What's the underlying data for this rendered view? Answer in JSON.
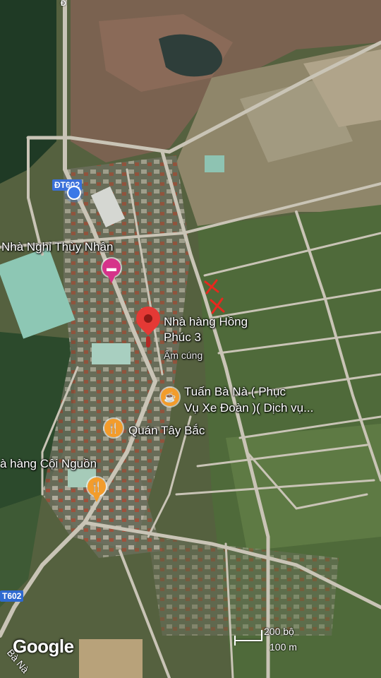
{
  "labels": {
    "hotel": "Nhà Nghỉ Thùy Nhân",
    "restaurant_main_line1": "Nhà hàng Hồng",
    "restaurant_main_line2": "Phúc 3",
    "restaurant_main_sub": "Ấm cúng",
    "tuan_line1": "Tuấn Bà Nà ( Phục",
    "tuan_line2": "Vụ Xe Đoàn )( Dịch vụ...",
    "quan_tay_bac": "Quán Tây Bắc",
    "coi_nguon": "à hàng Cội Nguồn"
  },
  "roads": {
    "dt602_top": "ĐT602",
    "t602_bottom": "T602",
    "ba_na": "Bà Nà",
    "top_marker": "Đ"
  },
  "scale": {
    "feet": "200 bộ",
    "meters": "100 m"
  },
  "brand": "Google",
  "colors": {
    "location_dot": "#3b78e7",
    "red_pin": "#e53935",
    "pink_poi": "#d6338a",
    "orange_poi": "#f39c2b",
    "cross_marks": "#e8281e"
  },
  "icons": [
    "my-location-icon",
    "hotel-icon",
    "red-pin-icon",
    "coffee-icon",
    "restaurant-icon",
    "restaurant-icon",
    "x-mark-icon"
  ]
}
